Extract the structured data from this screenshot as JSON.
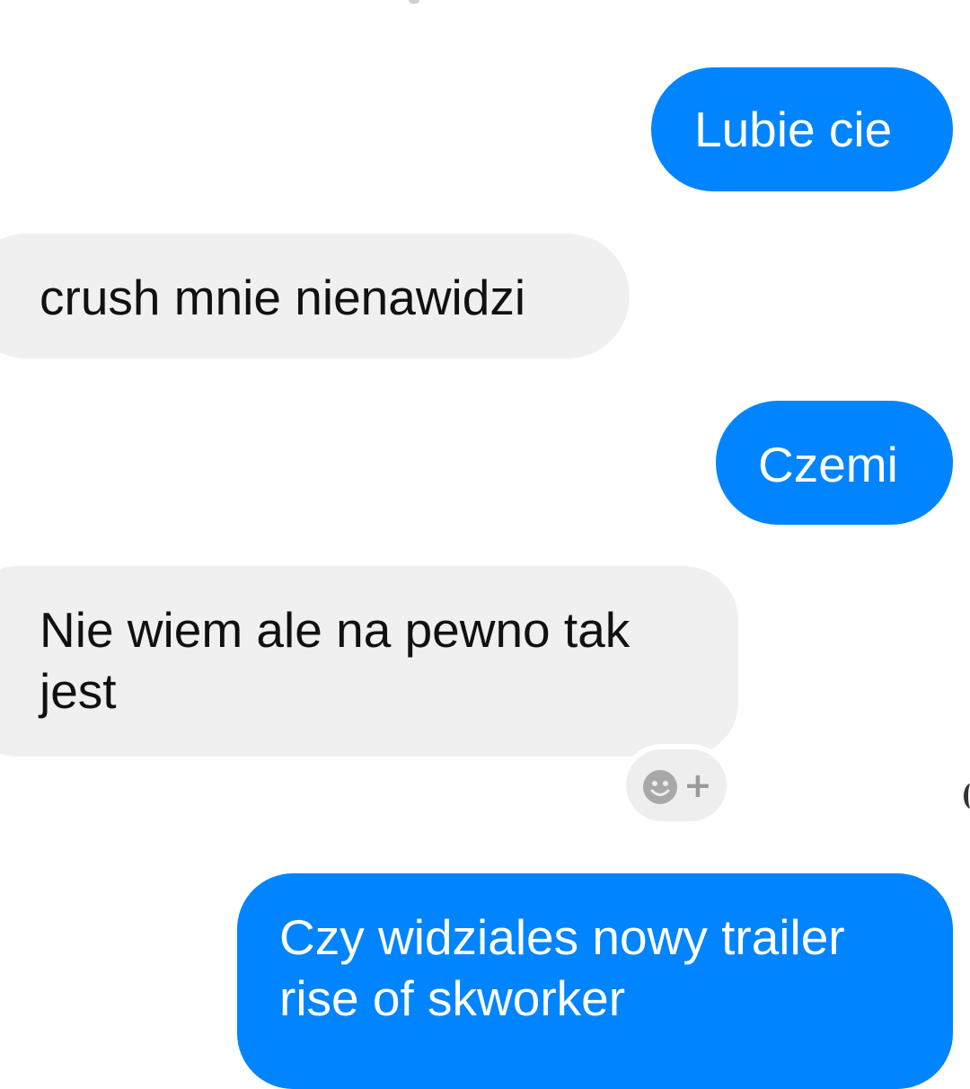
{
  "conversation": {
    "messages": [
      {
        "direction": "sent",
        "text": "Lubie cie"
      },
      {
        "direction": "received",
        "text": "crush mnie nienawidzi"
      },
      {
        "direction": "sent",
        "text": "Czemi"
      },
      {
        "direction": "received",
        "text": "Nie wiem ale na pewno tak jest"
      },
      {
        "direction": "sent",
        "text": "Czy widziales nowy trailer rise of skworker"
      }
    ],
    "reaction_button": {
      "icon": "smiley-add-icon",
      "plus_symbol": "+"
    }
  },
  "colors": {
    "sent_bubble": "#0084ff",
    "received_bubble": "#f0f0f0",
    "sent_text": "#ffffff",
    "received_text": "#111111",
    "reaction_icon": "#9a9a9a"
  }
}
